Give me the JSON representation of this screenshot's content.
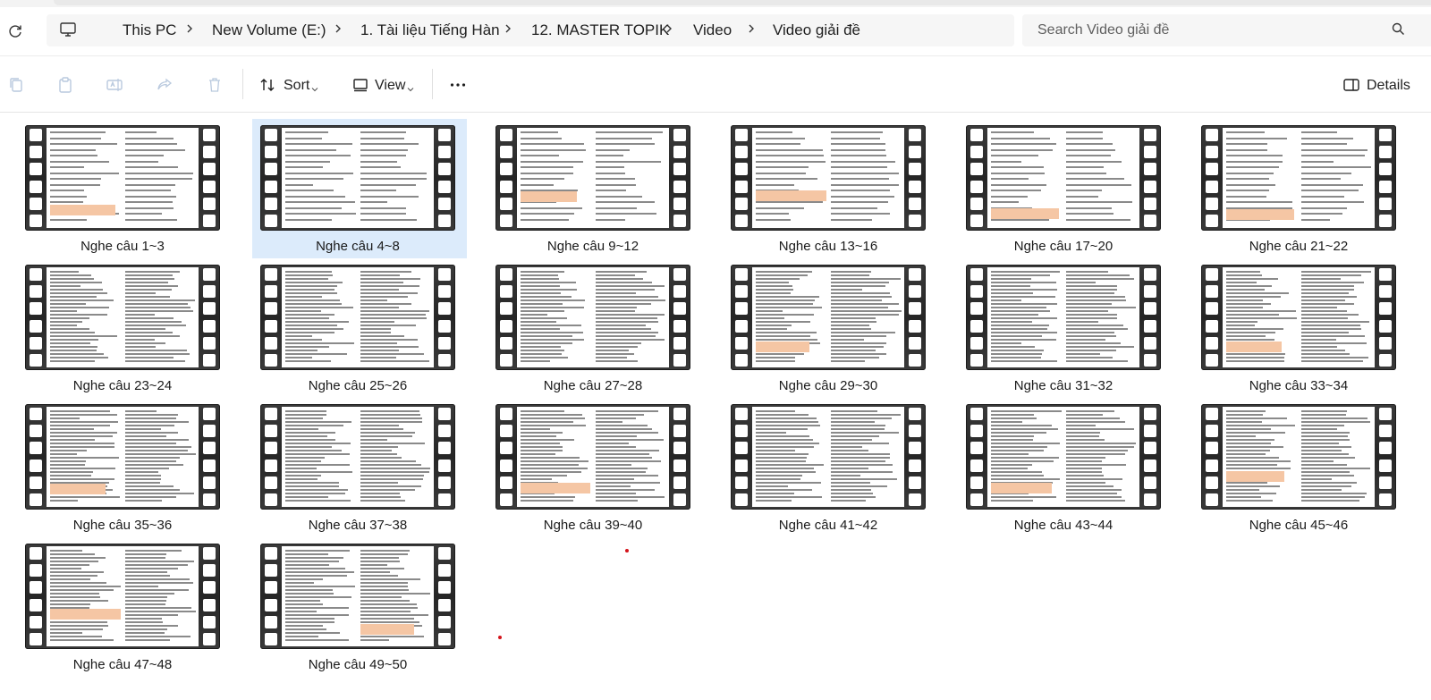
{
  "address": {
    "crumbs": [
      "This PC",
      "New Volume (E:)",
      "1. Tài liệu Tiếng Hàn",
      "12. MASTER TOPIK",
      "Video",
      "Video giải đề"
    ],
    "search_placeholder": "Search Video giải đề"
  },
  "toolbar": {
    "sort_label": "Sort",
    "view_label": "View",
    "details_label": "Details"
  },
  "files": [
    {
      "name": "Nghe câu 1~3"
    },
    {
      "name": "Nghe câu 4~8",
      "selected": true
    },
    {
      "name": "Nghe câu 9~12"
    },
    {
      "name": "Nghe câu 13~16"
    },
    {
      "name": "Nghe câu 17~20"
    },
    {
      "name": "Nghe câu 21~22"
    },
    {
      "name": "Nghe câu 23~24"
    },
    {
      "name": "Nghe câu 25~26"
    },
    {
      "name": "Nghe câu 27~28"
    },
    {
      "name": "Nghe câu 29~30"
    },
    {
      "name": "Nghe câu 31~32"
    },
    {
      "name": "Nghe câu 33~34"
    },
    {
      "name": "Nghe câu 35~36"
    },
    {
      "name": "Nghe câu 37~38"
    },
    {
      "name": "Nghe câu 39~40"
    },
    {
      "name": "Nghe câu 41~42"
    },
    {
      "name": "Nghe câu 43~44"
    },
    {
      "name": "Nghe câu 45~46"
    },
    {
      "name": "Nghe câu 47~48"
    },
    {
      "name": "Nghe câu 49~50"
    }
  ],
  "colors": {
    "selection": "#dcebfb",
    "accent": "#0067c0",
    "highlight": "#f5c6a4"
  },
  "icons": [
    "refresh-icon",
    "this-pc-icon",
    "search-icon",
    "copy-icon",
    "paste-icon",
    "rename-icon",
    "share-icon",
    "delete-icon",
    "sort-icon",
    "view-icon",
    "more-icon",
    "details-pane-icon"
  ]
}
